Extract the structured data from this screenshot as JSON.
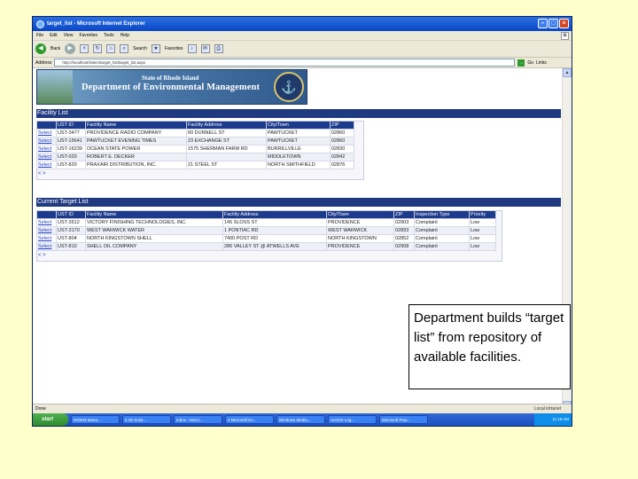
{
  "window": {
    "title": "target_list - Microsoft Internet Explorer",
    "menu": [
      "File",
      "Edit",
      "View",
      "Favorites",
      "Tools",
      "Help"
    ],
    "toolbar": {
      "back_label": "Back",
      "search_label": "Search",
      "favorites_label": "Favorites"
    },
    "address": {
      "label": "Address",
      "url": "http://localhost/ridem/target_list/target_list.aspx",
      "go_label": "Go",
      "links_label": "Links"
    }
  },
  "banner": {
    "state": "State of Rhode Island",
    "dept": "Department of Environmental Management"
  },
  "facility": {
    "header": "Facility List",
    "columns": [
      "",
      "UST ID",
      "Facility Name",
      "Facility Address",
      "City/Town",
      "ZIP"
    ],
    "rows": [
      {
        "select": "Select",
        "id": "UST-3477",
        "name": "PROVIDENCE RADIO COMPANY",
        "address": "60 DUNNELL ST",
        "city": "PAWTUCKET",
        "zip": "02860"
      },
      {
        "select": "Select",
        "id": "UST-15641",
        "name": "PAWTUCKET EVENING TIMES",
        "address": "23 EXCHANGE ST",
        "city": "PAWTUCKET",
        "zip": "02860"
      },
      {
        "select": "Select",
        "id": "UST-16239",
        "name": "OCEAN STATE POWER",
        "address": "1575 SHERMAN FARM RD",
        "city": "BURRILLVILLE",
        "zip": "02830"
      },
      {
        "select": "Select",
        "id": "UST-020",
        "name": "ROBERT E. DECKER",
        "address": "",
        "city": "MIDDLETOWN",
        "zip": "02842"
      },
      {
        "select": "Select",
        "id": "UST-820",
        "name": "PRAXAIR DISTRIBUTION, INC.",
        "address": "21 STEEL ST",
        "city": "NORTH SMITHFIELD",
        "zip": "02876"
      }
    ],
    "pager": "< >"
  },
  "target": {
    "header": "Current Target List",
    "columns": [
      "",
      "UST ID",
      "Facility Name",
      "Facility Address",
      "City/Town",
      "ZIP",
      "Inspection Type",
      "Priority"
    ],
    "rows": [
      {
        "select": "Select",
        "id": "UST-3512",
        "name": "VICTORY FINISHING TECHNOLOGIES, INC.",
        "address": "145 SLOSS ST",
        "city": "PROVIDENCE",
        "zip": "02903",
        "type": "Complaint",
        "priority": "Low"
      },
      {
        "select": "Select",
        "id": "UST-3170",
        "name": "WEST WARWICK WATER",
        "address": "1 PONTIAC RD",
        "city": "WEST WARWICK",
        "zip": "02893",
        "type": "Complaint",
        "priority": "Low"
      },
      {
        "select": "Select",
        "id": "UST-804",
        "name": "NORTH KINGSTOWN SHELL",
        "address": "7400 POST RD",
        "city": "NORTH KINGSTOWN",
        "zip": "02852",
        "type": "Complaint",
        "priority": "Low"
      },
      {
        "select": "Select",
        "id": "UST-810",
        "name": "SHELL OIL COMPANY",
        "address": "286 VALLEY ST @ ATWELLS AVE",
        "city": "PROVIDENCE",
        "zip": "02908",
        "type": "Complaint",
        "priority": "Low"
      }
    ],
    "pager": "< >"
  },
  "status": {
    "left": "Done",
    "zone": "Local intranet"
  },
  "taskbar": {
    "start": "start",
    "items": [
      "RIDEM Mana...",
      "2 Wi Solut...",
      "Inbox - Micro...",
      "3 Microsoft Ex...",
      "Windows Media...",
      "ArcGIS Log...",
      "Microsoft Pow..."
    ],
    "clock": "11:19 AM"
  },
  "callout": "Department builds “target list” from repository of available facilities."
}
